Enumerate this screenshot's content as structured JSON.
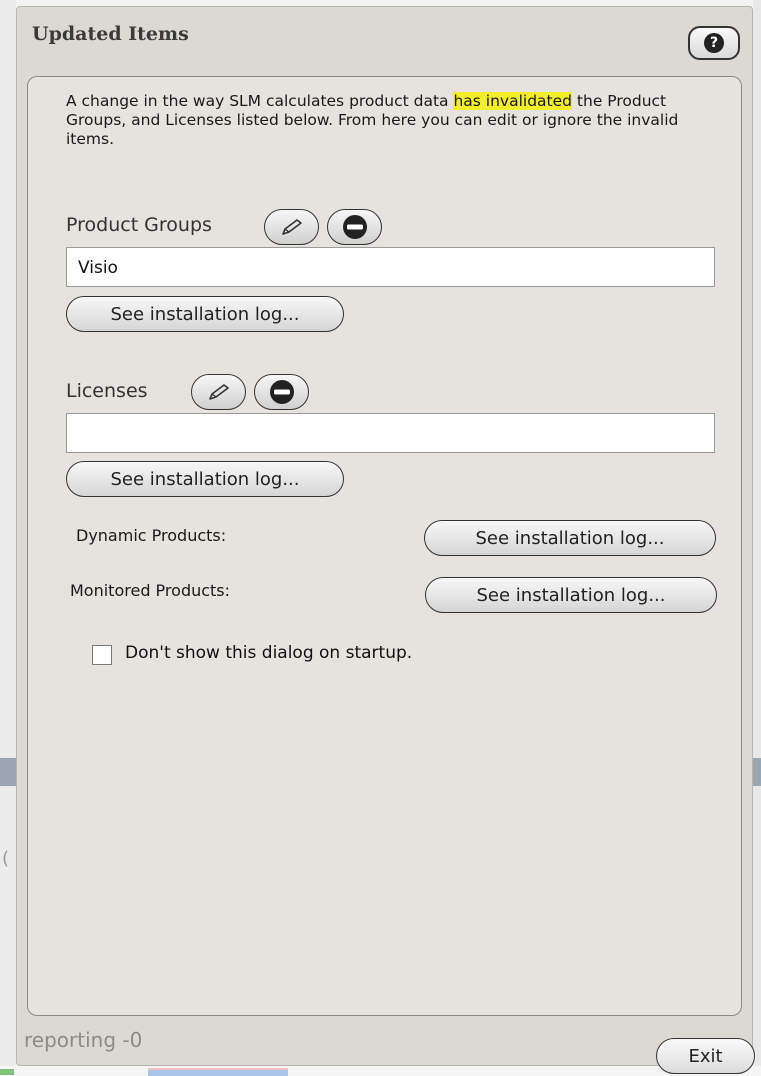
{
  "dialog": {
    "title": "Updated Items",
    "help_icon": "help-icon",
    "message_before": "A change in the way SLM calculates product data ",
    "message_highlight": "has invalidated",
    "message_after": " the Product Groups, and Licenses listed below. From here you can edit or ignore the invalid items.",
    "highlight_color": "#f2ee2a"
  },
  "product_groups": {
    "label": "Product Groups",
    "edit_icon": "pencil-icon",
    "remove_icon": "remove-icon",
    "value": "Visio",
    "log_button": "See installation log..."
  },
  "licenses": {
    "label": "Licenses",
    "edit_icon": "pencil-icon",
    "remove_icon": "remove-icon",
    "value": "",
    "log_button": "See installation log..."
  },
  "dynamic_products": {
    "label": "Dynamic Products:",
    "log_button": "See installation log..."
  },
  "monitored_products": {
    "label": "Monitored Products:",
    "log_button": "See installation log..."
  },
  "startup_checkbox": {
    "label": "Don't show this dialog on startup.",
    "checked": false
  },
  "background": {
    "footer_text": "reporting -0"
  },
  "footer": {
    "exit_label": "Exit"
  }
}
